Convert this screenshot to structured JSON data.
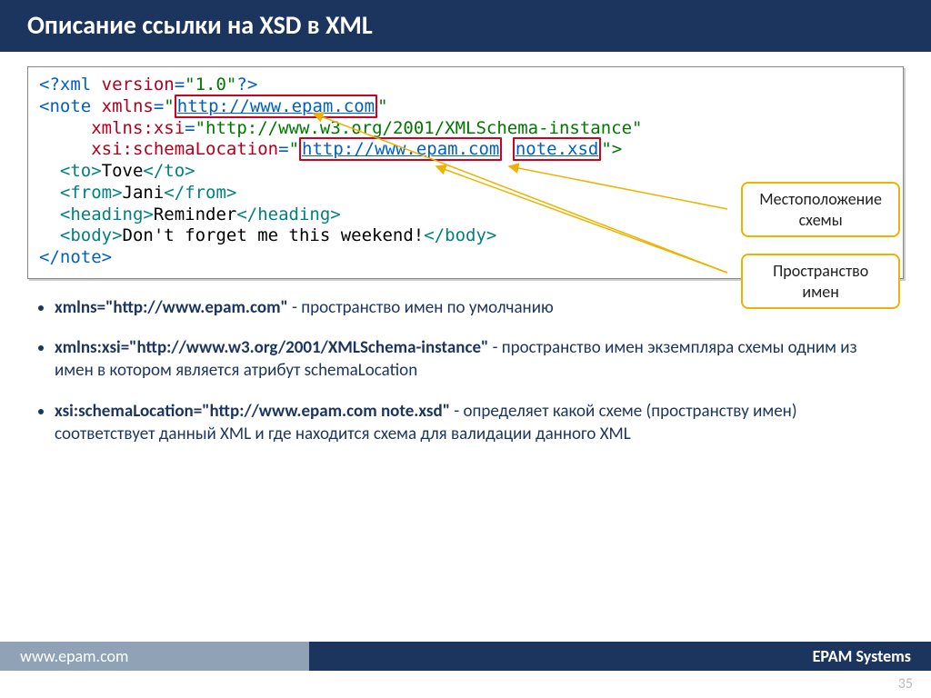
{
  "slide": {
    "title": "Описание ссылки на XSD в XML"
  },
  "code": {
    "l1_a": "<?xml ",
    "l1_b": "version",
    "l1_c": "=",
    "l1_d": "\"1.0\"",
    "l1_e": "?>",
    "l2_a": "<note ",
    "l2_b": "xmlns",
    "l2_c": "=",
    "l2_d": "\"",
    "l2_link1": "http://www.epam.com",
    "l2_f": "\"",
    "l3_a": "     ",
    "l3_b": "xmlns:xsi",
    "l3_c": "=",
    "l3_d": "\"http://www.w3.org/2001/XMLSchema-instance\"",
    "l4_a": "     ",
    "l4_b": "xsi:schemaLocation",
    "l4_c": "=",
    "l4_d": "\"",
    "l4_link1": "http://www.epam.com",
    "l4_sp": " ",
    "l4_link2": "note.xsd",
    "l4_f": "\">",
    "l5_a": "  <to>",
    "l5_b": "Tove",
    "l5_c": "</to>",
    "l6_a": "  <from>",
    "l6_b": "Jani",
    "l6_c": "</from>",
    "l7_a": "  <heading>",
    "l7_b": "Reminder",
    "l7_c": "</heading>",
    "l8_a": "  <body>",
    "l8_b": "Don't forget me this weekend!",
    "l8_c": "</body>",
    "l9_a": "</note>"
  },
  "callouts": {
    "c1_l1": "Местоположение",
    "c1_l2": "схемы",
    "c2_l1": "Пространство",
    "c2_l2": "имен"
  },
  "bullets": {
    "b1_lead": "xmlns=\"http://www.epam.com\"",
    "b1_rest": "  - пространство имен по умолчанию",
    "b2_lead": "xmlns:xsi=\"http://www.w3.org/2001/XMLSchema-instance\"",
    "b2_rest": " - пространство имен экземпляра схемы одним из имен в котором является атрибут schemaLocation",
    "b3_lead": "xsi:schemaLocation=\"http://www.epam.com note.xsd\"",
    "b3_rest": "  -  определяет какой схеме (пространству имен) соответствует данный XML и где находится схема для валидации данного XML"
  },
  "footer": {
    "left": "www.epam.com",
    "right": "EPAM Systems"
  },
  "page": "35"
}
